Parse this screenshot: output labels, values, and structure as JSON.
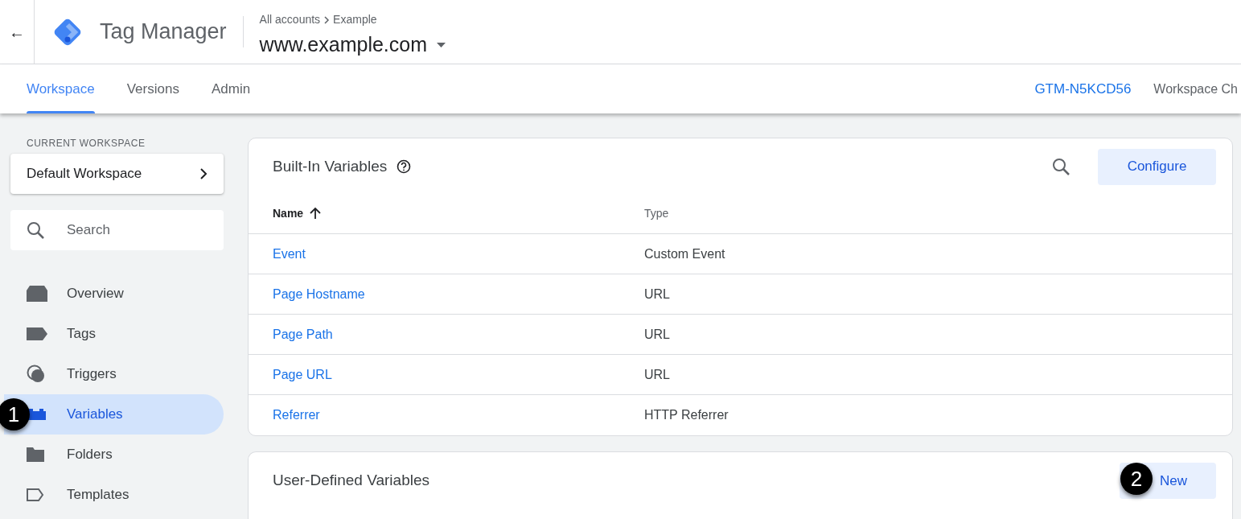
{
  "header": {
    "back": "←",
    "product": "Tag Manager",
    "breadcrumb": [
      "All accounts",
      "Example"
    ],
    "container": "www.example.com"
  },
  "tabs": [
    {
      "label": "Workspace",
      "selected": true
    },
    {
      "label": "Versions",
      "selected": false
    },
    {
      "label": "Admin",
      "selected": false
    }
  ],
  "container_id": "GTM-N5KCD56",
  "workspace_changes": "Workspace Ch",
  "sidebar": {
    "section_label": "CURRENT WORKSPACE",
    "workspace": "Default Workspace",
    "search": {
      "placeholder": "Search"
    },
    "items": [
      {
        "label": "Overview",
        "kind": "overview",
        "selected": false
      },
      {
        "label": "Tags",
        "kind": "tags",
        "selected": false
      },
      {
        "label": "Triggers",
        "kind": "triggers",
        "selected": false
      },
      {
        "label": "Variables",
        "kind": "variables",
        "selected": true
      },
      {
        "label": "Folders",
        "kind": "folders",
        "selected": false
      },
      {
        "label": "Templates",
        "kind": "templates",
        "selected": false
      }
    ]
  },
  "built_in": {
    "title": "Built-In Variables",
    "button": "Configure",
    "columns": [
      "Name",
      "Type"
    ],
    "rows": [
      {
        "name": "Event",
        "type": "Custom Event"
      },
      {
        "name": "Page Hostname",
        "type": "URL"
      },
      {
        "name": "Page Path",
        "type": "URL"
      },
      {
        "name": "Page URL",
        "type": "URL"
      },
      {
        "name": "Referrer",
        "type": "HTTP Referrer"
      }
    ]
  },
  "user_defined": {
    "title": "User-Defined Variables",
    "button": "New"
  },
  "callouts": [
    "1",
    "2"
  ]
}
